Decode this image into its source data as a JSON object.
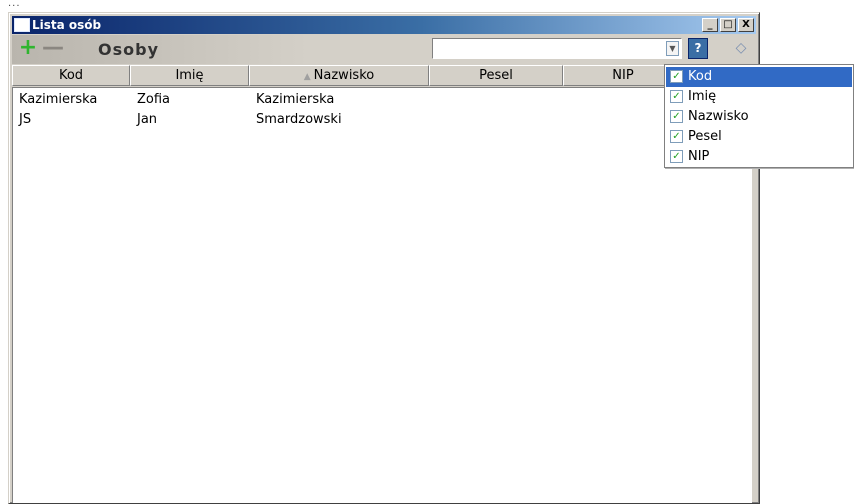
{
  "top_dots": "...",
  "window": {
    "title": "Lista osób",
    "minimize_label": "_",
    "maximize_label": "□",
    "close_label": "X"
  },
  "toolbar": {
    "add_label": "+",
    "remove_label": "—",
    "title": "Osoby",
    "search_value": "",
    "refresh_label": "?"
  },
  "table": {
    "sorted_column": "Nazwisko",
    "columns": [
      "Kod",
      "Imię",
      "Nazwisko",
      "Pesel",
      "NIP"
    ],
    "rows": [
      {
        "kod": "Kazimierska",
        "imie": "Zofia",
        "nazwisko": "Kazimierska",
        "pesel": "",
        "nip": ""
      },
      {
        "kod": "JS",
        "imie": "Jan",
        "nazwisko": "Smardzowski",
        "pesel": "",
        "nip": ""
      }
    ]
  },
  "column_chooser": {
    "items": [
      {
        "label": "Kod",
        "checked": true,
        "selected": true
      },
      {
        "label": "Imię",
        "checked": true,
        "selected": false
      },
      {
        "label": "Nazwisko",
        "checked": true,
        "selected": false
      },
      {
        "label": "Pesel",
        "checked": true,
        "selected": false
      },
      {
        "label": "NIP",
        "checked": true,
        "selected": false
      }
    ]
  },
  "colors": {
    "title_gradient_start": "#0a246a",
    "selection": "#316ac5",
    "add_icon": "#2fb52f"
  }
}
